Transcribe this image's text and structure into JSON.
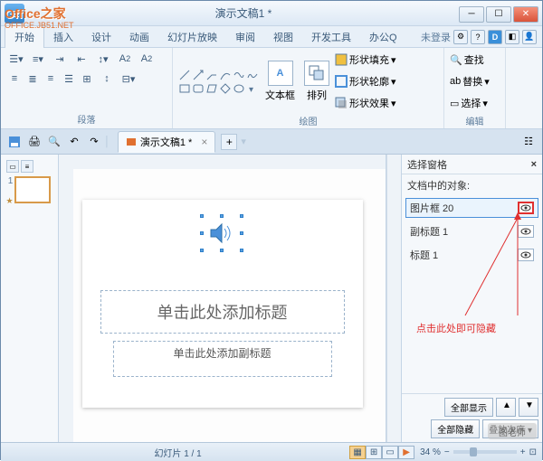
{
  "window": {
    "title": "演示文稿1 *"
  },
  "watermark": {
    "top": "Office之家",
    "sub": "OFFICE.JB51.NET",
    "bottom": "图老师"
  },
  "menubar": {
    "tabs": [
      "开始",
      "插入",
      "设计",
      "动画",
      "幻灯片放映",
      "审阅",
      "视图",
      "开发工具",
      "办公Q"
    ],
    "login": "未登录",
    "d": "D"
  },
  "ribbon": {
    "group_paragraph": "段落",
    "group_drawing": "绘图",
    "group_edit": "编辑",
    "textbox": "文本框",
    "arrange": "排列",
    "shape_fill": "形状填充",
    "shape_outline": "形状轮廓",
    "shape_effect": "形状效果",
    "find": "查找",
    "replace": "替换",
    "select": "选择"
  },
  "document": {
    "tab_label": "演示文稿1 *"
  },
  "slide": {
    "number": "1",
    "title_ph": "单击此处添加标题",
    "subtitle_ph": "单击此处添加副标题"
  },
  "taskpane": {
    "title": "选择窗格",
    "label": "文档中的对象:",
    "items": [
      {
        "name": "图片框 20",
        "selected": true
      },
      {
        "name": "副标题 1",
        "selected": false
      },
      {
        "name": "标题 1",
        "selected": false
      }
    ],
    "annotation": "点击此处即可隐藏",
    "show_all": "全部显示",
    "hide_all": "全部隐藏",
    "reorder": "叠放次序"
  },
  "status": {
    "slide_info": "幻灯片 1 / 1",
    "zoom": "34 %"
  }
}
